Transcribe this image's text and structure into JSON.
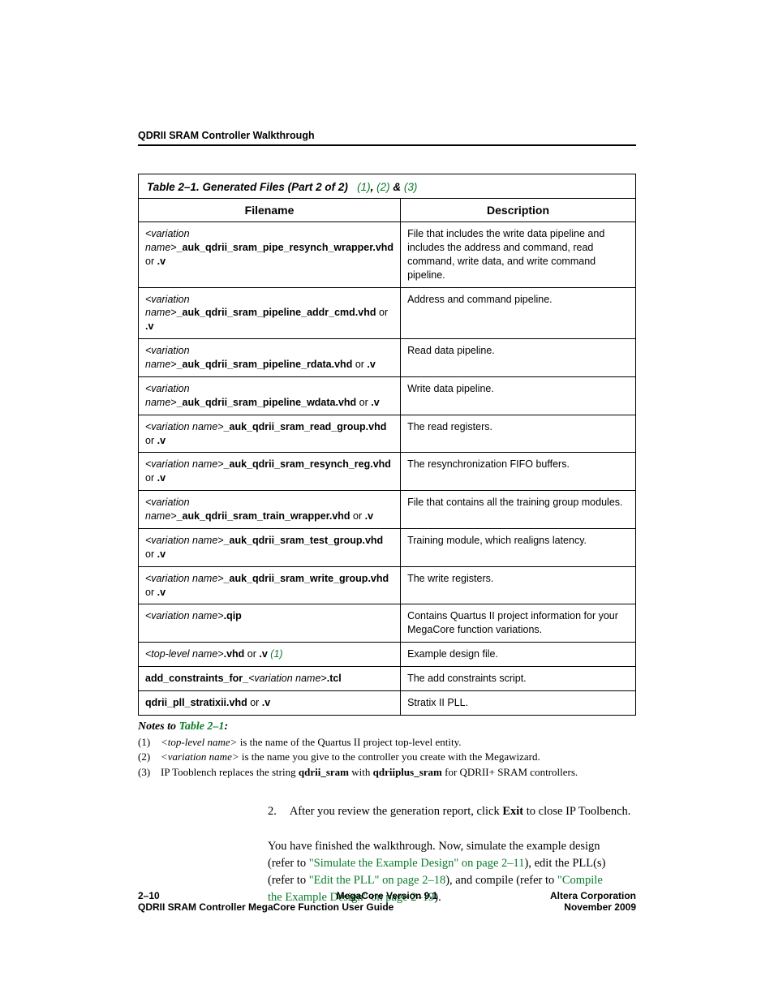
{
  "header": {
    "section_title": "QDRII SRAM Controller Walkthrough"
  },
  "table": {
    "caption_prefix": "Table 2–1. Generated Files  (Part 2 of 2)",
    "refs": [
      "(1)",
      "(2)",
      "(3)"
    ],
    "head_filename": "Filename",
    "head_description": "Description",
    "rows": [
      {
        "filename_prefix": "<variation name>",
        "filename_suffix": "_auk_qdrii_sram_pipe_resynch_wrapper.vhd",
        "filename_or": " or ",
        "filename_ext2": ".v",
        "description": "File that includes the write data pipeline and includes the address and command, read command, write data, and write command pipeline."
      },
      {
        "filename_prefix": "<variation name>",
        "filename_suffix": "_auk_qdrii_sram_pipeline_addr_cmd.vhd",
        "filename_or": " or ",
        "filename_ext2": ".v",
        "description": "Address and command pipeline."
      },
      {
        "filename_prefix": "<variation name>",
        "filename_suffix": "_auk_qdrii_sram_pipeline_rdata.vhd",
        "filename_or": " or ",
        "filename_ext2": ".v",
        "description": "Read data pipeline."
      },
      {
        "filename_prefix": "<variation name>",
        "filename_suffix": "_auk_qdrii_sram_pipeline_wdata.vhd",
        "filename_or": " or ",
        "filename_ext2": ".v",
        "description": "Write data pipeline."
      },
      {
        "filename_prefix": "<variation name>",
        "filename_suffix": "_auk_qdrii_sram_read_group.vhd",
        "filename_or": " or ",
        "filename_ext2": ".v",
        "description": "The read registers."
      },
      {
        "filename_prefix": "<variation name>",
        "filename_suffix": "_auk_qdrii_sram_resynch_reg.vhd",
        "filename_or": " or ",
        "filename_ext2": ".v",
        "description": "The resynchronization FIFO buffers."
      },
      {
        "filename_prefix": "<variation name>",
        "filename_suffix": "_auk_qdrii_sram_train_wrapper.vhd",
        "filename_or": " or ",
        "filename_ext2": ".v",
        "description": "File that contains all the training group modules."
      },
      {
        "filename_prefix": "<variation name>",
        "filename_suffix": "_auk_qdrii_sram_test_group.vhd",
        "filename_or": " or ",
        "filename_ext2": ".v",
        "description": "Training module, which realigns latency."
      },
      {
        "filename_prefix": "<variation name>",
        "filename_suffix": "_auk_qdrii_sram_write_group.vhd",
        "filename_or": " or ",
        "filename_ext2": ".v",
        "description": "The write registers."
      },
      {
        "filename_prefix": "<variation name>",
        "filename_suffix": ".qip",
        "filename_or": "",
        "filename_ext2": "",
        "description": "Contains Quartus II project information for your MegaCore function variations."
      },
      {
        "filename_prefix": "<top-level name>",
        "filename_suffix": ".vhd",
        "filename_or": " or ",
        "filename_ext2": ".v",
        "filename_trailing_ref": "(1)",
        "description": "Example design file."
      },
      {
        "filename_literal_pre": "add_constraints_for_",
        "filename_prefix": "<variation name>",
        "filename_suffix": ".tcl",
        "filename_or": "",
        "filename_ext2": "",
        "description": "The add constraints script."
      },
      {
        "filename_literal_full": "qdrii_pll_stratixii.vhd",
        "filename_or": " or ",
        "filename_ext2": ".v",
        "description": "Stratix II PLL."
      }
    ]
  },
  "notes": {
    "heading_prefix": "Notes to ",
    "heading_ref": "Table 2–1",
    "heading_suffix": ":",
    "items": [
      {
        "num": "(1)",
        "text_before_italic": "",
        "italic": "<top-level name>",
        "text_after_italic": " is the name of the Quartus II project top-level entity."
      },
      {
        "num": "(2)",
        "text_before_italic": "",
        "italic": "<variation name>",
        "text_after_italic": " is the name you give to the controller you create with the Megawizard."
      },
      {
        "num": "(3)",
        "text_plain_before": "IP Tooblench replaces the string ",
        "bold1": "qdrii_sram",
        "text_mid": " with ",
        "bold2": "qdriiplus_sram",
        "text_after": " for QDRII+ SRAM controllers."
      }
    ]
  },
  "step": {
    "num": "2.",
    "text_before_bold": "After you review the generation report, click ",
    "bold": "Exit",
    "text_after_bold": " to close IP Toolbench."
  },
  "closing": {
    "line1_before_link": "You have finished the walkthrough. Now, simulate the example design (refer to ",
    "link1": "\"Simulate the Example Design\" on page 2–11",
    "line1_after_link": "), edit the PLL(s) (refer to ",
    "link2": "\"Edit the PLL\" on page 2–18",
    "line2_after_link": "), and compile (refer to ",
    "link3": "\"Compile the Example Design\" on page 2–19",
    "line3_after_link": ")."
  },
  "footer": {
    "page_num": "2–10",
    "left_line2": "QDRII SRAM Controller MegaCore Function User Guide",
    "center": "MegaCore Version 9.1",
    "right_line1": "Altera Corporation",
    "right_line2": "November 2009"
  }
}
